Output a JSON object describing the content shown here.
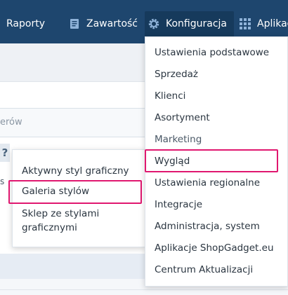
{
  "nav": {
    "items": [
      {
        "label": "Raporty",
        "icon": null
      },
      {
        "label": "Zawartość",
        "icon": "document-icon"
      },
      {
        "label": "Konfiguracja",
        "icon": "gear-icon"
      },
      {
        "label": "Aplikac",
        "icon": "grid-icon"
      }
    ],
    "colors": {
      "bar": "#1e466e",
      "active": "#163a5c",
      "accent": "#e0176f"
    }
  },
  "background": {
    "filter_fragment": "erów",
    "help_glyph": "?",
    "stray_letter": "s"
  },
  "submenu": {
    "items": [
      "Aktywny styl graficzny",
      "Galeria stylów",
      "Sklep ze stylami graficznymi"
    ],
    "highlighted": "Galeria stylów"
  },
  "config_menu": {
    "items": [
      "Ustawienia podstawowe",
      "Sprzedaż",
      "Klienci",
      "Asortyment",
      "Marketing",
      "Wygląd",
      "Ustawienia regionalne",
      "Integracje",
      "Administracja, system",
      "Aplikacje ShopGadget.eu",
      "Centrum Aktualizacji"
    ],
    "highlighted": "Wygląd"
  }
}
